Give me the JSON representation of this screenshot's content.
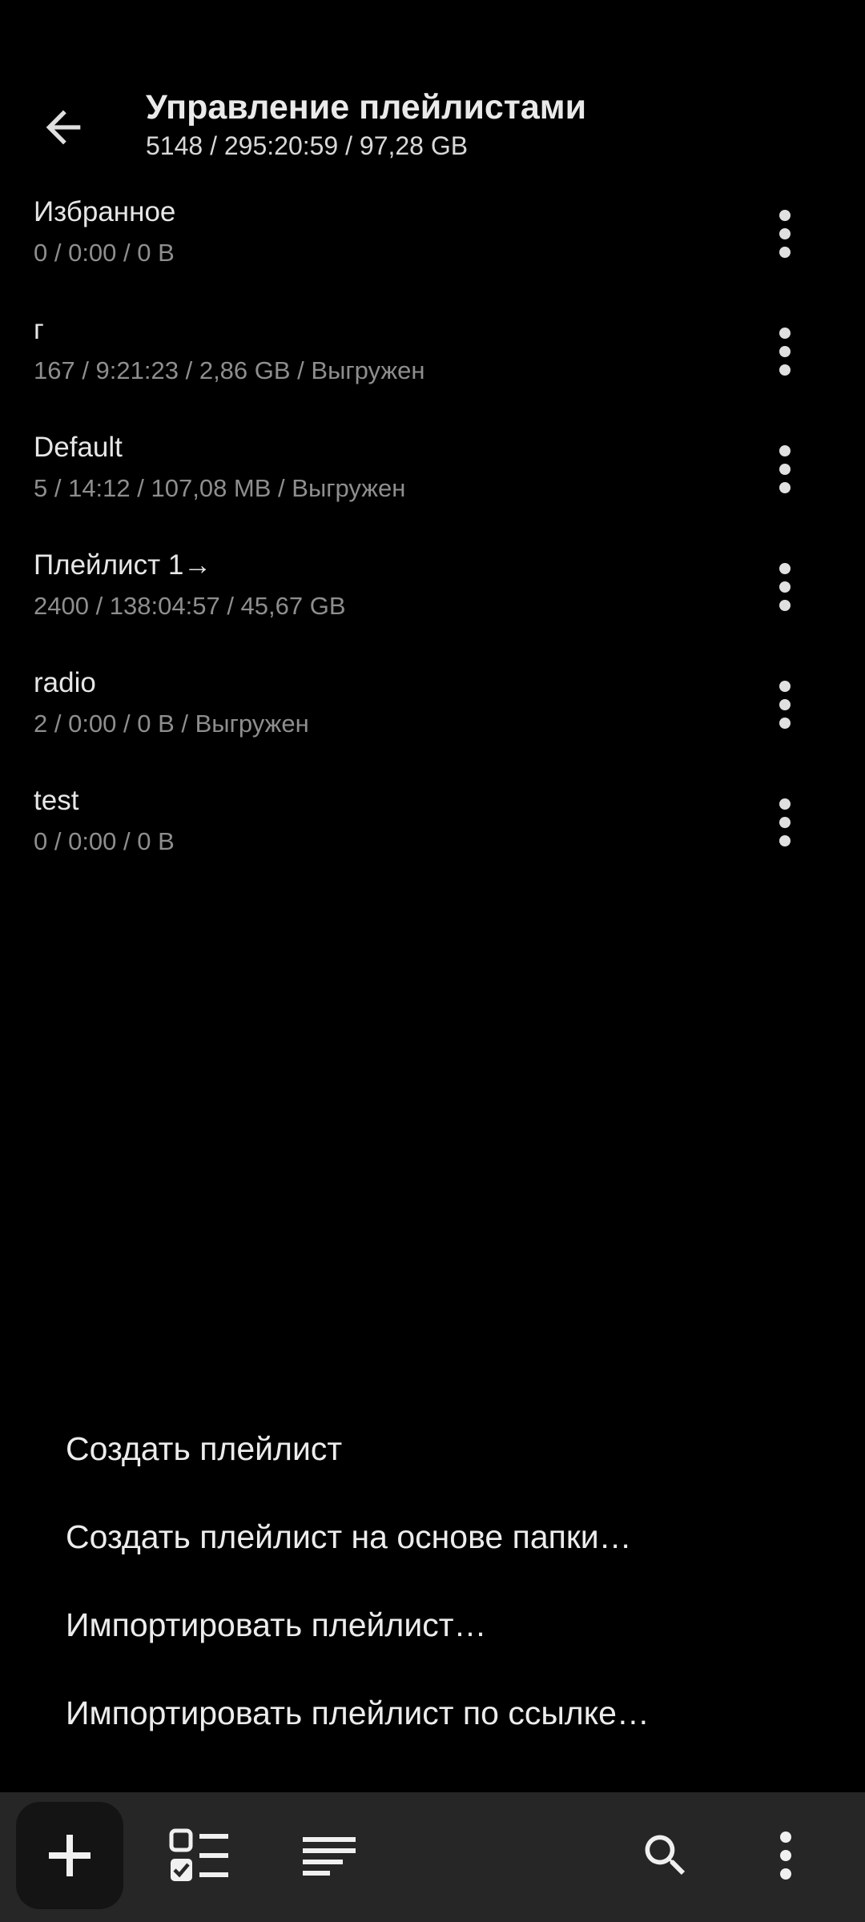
{
  "header": {
    "title": "Управление плейлистами",
    "subtitle": "5148 / 295:20:59 / 97,28 GB",
    "back_icon": "arrow-back-icon"
  },
  "playlists": [
    {
      "name": "Избранное",
      "info": "0 / 0:00 / 0 B"
    },
    {
      "name": "г",
      "info": "167 / 9:21:23 / 2,86 GB / Выгружен"
    },
    {
      "name": "Default",
      "info": "5 / 14:12 / 107,08 MB / Выгружен"
    },
    {
      "name": "Плейлист 1→",
      "info": "2400 / 138:04:57 / 45,67 GB"
    },
    {
      "name": "radio",
      "info": "2 / 0:00 / 0 B / Выгружен"
    },
    {
      "name": "test",
      "info": "0 / 0:00 / 0 B"
    }
  ],
  "menu": {
    "items": [
      "Создать плейлист",
      "Создать плейлист на основе папки…",
      "Импортировать плейлист…",
      "Импортировать плейлист по ссылке…"
    ]
  },
  "toolbar": {
    "icons": [
      "plus-icon",
      "checklist-icon",
      "sort-lines-icon",
      "search-icon",
      "more-vert-icon"
    ]
  },
  "colors": {
    "background": "#000000",
    "toolbar": "#262626",
    "text_primary": "#e6e6e6",
    "text_secondary": "#8e8e8e"
  }
}
